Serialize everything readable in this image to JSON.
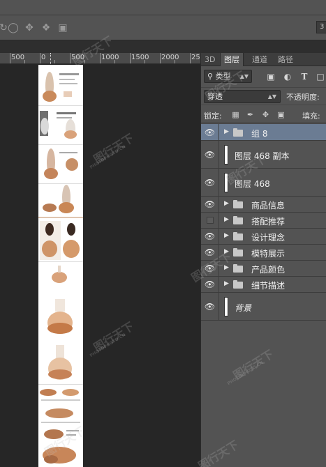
{
  "options_bar": {
    "icons": [
      "orbit-icon",
      "roll-icon",
      "pan-icon",
      "slide-icon",
      "camera-icon"
    ],
    "right_value": "3"
  },
  "ruler": {
    "labels": [
      "500",
      "0",
      "500",
      "1000",
      "1500",
      "2000",
      "25"
    ]
  },
  "canvas": {
    "document_bg": "#ffffff"
  },
  "panel": {
    "tabs": [
      {
        "label": "3D",
        "active": false
      },
      {
        "label": "图层",
        "active": true
      },
      {
        "label": "通道",
        "active": false
      },
      {
        "label": "路径",
        "active": false
      }
    ],
    "filter": {
      "search_icon": "search-icon",
      "type_label": "类型",
      "icons": [
        "image-filter-icon",
        "adjustment-filter-icon",
        "text-filter-icon",
        "shape-filter-icon"
      ]
    },
    "blend": {
      "mode": "穿透",
      "opacity_label": "不透明度:"
    },
    "lock": {
      "label": "锁定:",
      "icons": [
        "lock-transparent-icon",
        "lock-paint-icon",
        "lock-move-icon",
        "lock-all-icon"
      ],
      "fill_label": "填充:"
    },
    "layers": [
      {
        "name": "组 8",
        "kind": "group",
        "visible": true,
        "selected": true
      },
      {
        "name": "图层 468 副本",
        "kind": "layer",
        "visible": true,
        "selected": false
      },
      {
        "name": "图层 468",
        "kind": "layer",
        "visible": true,
        "selected": false
      },
      {
        "name": "商品信息",
        "kind": "group",
        "visible": true,
        "selected": false
      },
      {
        "name": "搭配推荐",
        "kind": "group",
        "visible": false,
        "selected": false
      },
      {
        "name": "设计理念",
        "kind": "group",
        "visible": true,
        "selected": false
      },
      {
        "name": "模特展示",
        "kind": "group",
        "visible": true,
        "selected": false
      },
      {
        "name": "产品颜色",
        "kind": "group",
        "visible": true,
        "selected": false
      },
      {
        "name": "细节描述",
        "kind": "group",
        "visible": true,
        "selected": false
      },
      {
        "name": "背景",
        "kind": "background",
        "visible": true,
        "selected": false
      }
    ]
  },
  "watermark": {
    "text": "图行天下",
    "sub": "PHOTOPHOTO.CN"
  }
}
